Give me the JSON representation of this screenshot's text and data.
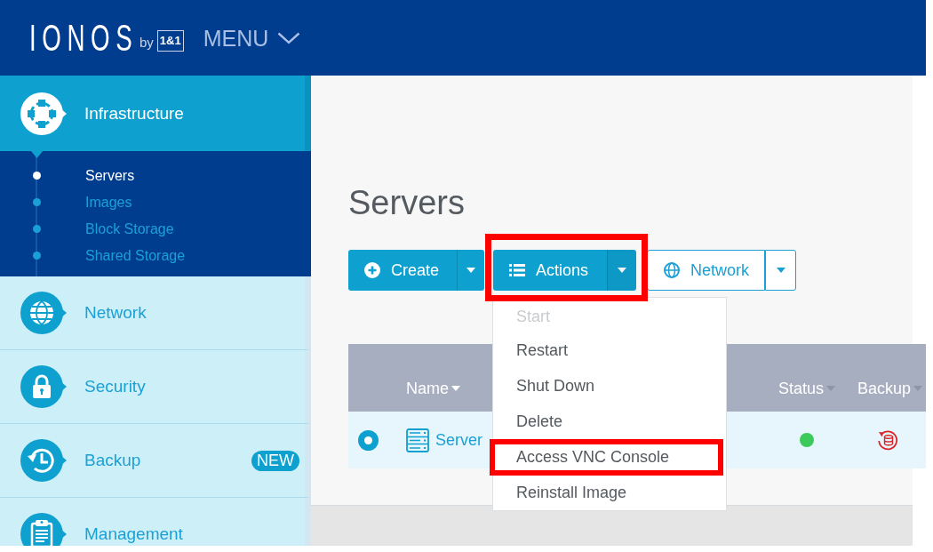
{
  "header": {
    "logo": {
      "wordmark": "IONOS",
      "tagline": "by",
      "badge": "1&1"
    },
    "menu": {
      "label": "MENU"
    }
  },
  "sidebar": {
    "items": [
      {
        "label": "Infrastructure",
        "selected": true,
        "expanded": true,
        "children": [
          {
            "label": "Servers",
            "selected": true
          },
          {
            "label": "Images",
            "selected": false
          },
          {
            "label": "Block Storage",
            "selected": false
          },
          {
            "label": "Shared Storage",
            "selected": false
          }
        ]
      },
      {
        "label": "Network",
        "selected": false,
        "expanded": false
      },
      {
        "label": "Security",
        "selected": false,
        "expanded": false
      },
      {
        "label": "Backup",
        "selected": false,
        "expanded": false,
        "badge": "NEW"
      },
      {
        "label": "Management",
        "selected": false,
        "expanded": false
      }
    ]
  },
  "page": {
    "title": "Servers"
  },
  "toolbar": {
    "buttons": [
      {
        "label": "Create",
        "kind": "solid",
        "highlighted": false,
        "expanded": false
      },
      {
        "label": "Actions",
        "kind": "solid",
        "highlighted": true,
        "expanded": true,
        "menu": [
          {
            "label": "Start",
            "disabled": true,
            "highlighted": false
          },
          {
            "label": "Restart",
            "disabled": false,
            "highlighted": false
          },
          {
            "label": "Shut Down",
            "disabled": false,
            "highlighted": false
          },
          {
            "label": "Delete",
            "disabled": false,
            "highlighted": false
          },
          {
            "label": "Access VNC Console",
            "disabled": false,
            "highlighted": true
          },
          {
            "label": "Reinstall Image",
            "disabled": false,
            "highlighted": false
          }
        ]
      },
      {
        "label": "Network",
        "kind": "outline",
        "highlighted": false,
        "expanded": false
      }
    ]
  },
  "table": {
    "columns": [
      {
        "label": "Name",
        "sorted": true
      },
      {
        "label": "Status",
        "sorted": false
      },
      {
        "label": "Backup",
        "sorted": false
      }
    ],
    "rows": [
      {
        "selected": true,
        "name": "Server",
        "status": {
          "color": "#3cca5a"
        }
      }
    ]
  }
}
